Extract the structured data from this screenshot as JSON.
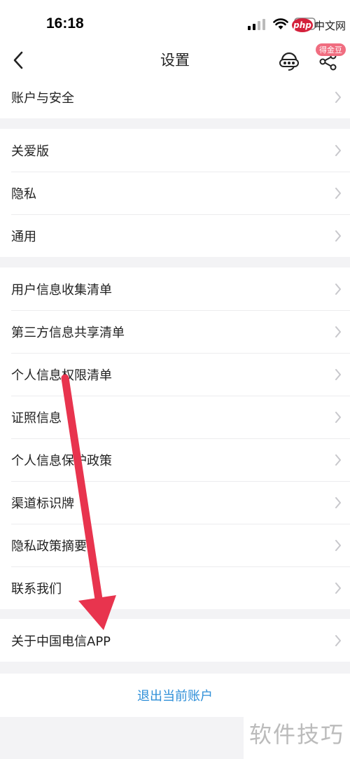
{
  "status_bar": {
    "time": "16:18"
  },
  "watermark": {
    "top_badge": "php",
    "top_text": "中文网",
    "bottom_text": "软件技巧"
  },
  "nav": {
    "title": "设置",
    "coin_badge": "得金豆"
  },
  "groups": [
    {
      "items": [
        {
          "label": "账户与安全"
        }
      ]
    },
    {
      "items": [
        {
          "label": "关爱版"
        },
        {
          "label": "隐私"
        },
        {
          "label": "通用"
        }
      ]
    },
    {
      "items": [
        {
          "label": "用户信息收集清单"
        },
        {
          "label": "第三方信息共享清单"
        },
        {
          "label": "个人信息权限清单"
        },
        {
          "label": "证照信息"
        },
        {
          "label": "个人信息保护政策"
        },
        {
          "label": "渠道标识牌"
        },
        {
          "label": "隐私政策摘要"
        },
        {
          "label": "联系我们"
        }
      ]
    },
    {
      "items": [
        {
          "label": "关于中国电信APP"
        }
      ]
    }
  ],
  "logout_label": "退出当前账户",
  "colors": {
    "accent": "#2f8fd8",
    "annotation_arrow": "#e8344e",
    "badge": "#f06d80"
  }
}
